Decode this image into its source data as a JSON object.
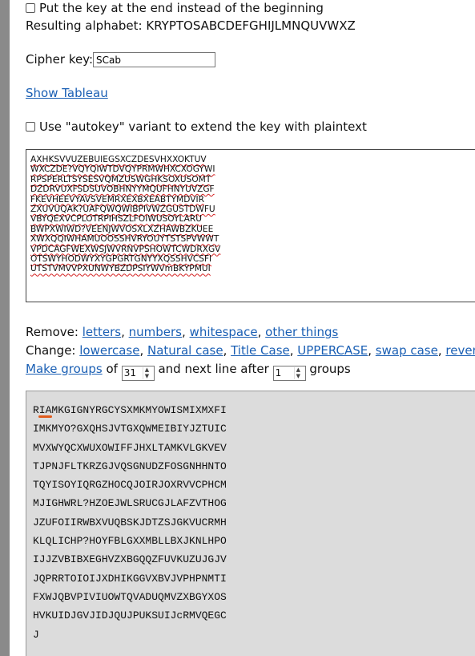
{
  "options": {
    "key_at_end_label": "Put the key at the end instead of the beginning",
    "resulting_alphabet_label": "Resulting alphabet:",
    "resulting_alphabet_value": "KRYPTOSABCDEFGHIJLMNQUVWXZ",
    "cipher_key_label": "Cipher key:",
    "cipher_key_value": "SCab",
    "show_tableau_link": "Show Tableau",
    "autokey_label": "Use \"autokey\" variant to extend the key with plaintext"
  },
  "input_text": {
    "lines": [
      "AXHKSVVUZEBUIEGSXCZDESVHXXOKTUV",
      "WXCZDE?VQYQIWTDVQYPRMWHXCXOGYWI",
      "RPSPERLTSYSESVQMZUSWGHKSOXUSOMT",
      "DZDRVUXFSDSUVOBHNYYMQUFHNYUVZGF",
      "FKEVHEEVYAVSVEMRXEXBXEABTYMDVIR",
      "ZXUVUQAK?UAFQWQWIBPIVWZGUSTDWFU",
      "VBYQEXVCPLOTRPIHSZLFOIWUSOYLARU",
      "BWPXWIWD?VEENJWVOSXLXZHAWBZKUEE",
      "XWXQQIWHAMUOOSSHVRYOUYTSTSPVWWT",
      "VPDCAGFWEXWSJWVRNVPSHOWTCWDRXGV",
      "OTSWYHODWYXYGPGRTGNYYXQSSHVCSFI",
      "UTSTVMVVPXUNWYBZDPSIYWVmBKYPMUI"
    ]
  },
  "controls": {
    "remove_label": "Remove:",
    "remove_links": [
      "letters",
      "numbers",
      "whitespace",
      "other things"
    ],
    "change_label": "Change:",
    "change_links": [
      "lowercase",
      "Natural case",
      "Title Case",
      "UPPERCASE",
      "swap case",
      "reverse"
    ],
    "make_groups_link": "Make groups",
    "of_text": "of",
    "group_size": "31",
    "next_line_text": "and next line after",
    "groups_per_line": "1",
    "groups_text": "groups"
  },
  "output_text": {
    "lines": [
      "RIAMKGIGNYRGCYSXMKMYOWISMIXMXFI",
      "IMKMYO?GXQHSJVTGXQWMEIBIYJZTUIC",
      "MVXWYQCXWUXOWIFFJHXLTAMKVLGKVEV",
      "TJPNJFLTKRZGJVQSGNUDZFOSGNHHNTO",
      "TQYISOYIQRGZHOCQJOIRJOXRVVCPHCM",
      "MJIGHWRL?HZOEJWLSRUCGJLAFZVTHOG",
      "JZUFOIIRWBXVUQBSKJDTZSJGKVUCRMH",
      "KLQLICHP?HOYFBLGXXMBLLBXJKNLHPO",
      "IJJZVBIBXEGHVZXBGQQZFUVKUZUJGJV",
      "JQPRRTOIOIJXDHIKGGVXBVJVPHPNMTI",
      "FXWJQBVPIVIUOWTQVADUQMVZXBGYXOS",
      "HVKUIDJGVJIDJQUJPUKSUIJcRMVQEGC",
      "J"
    ]
  }
}
